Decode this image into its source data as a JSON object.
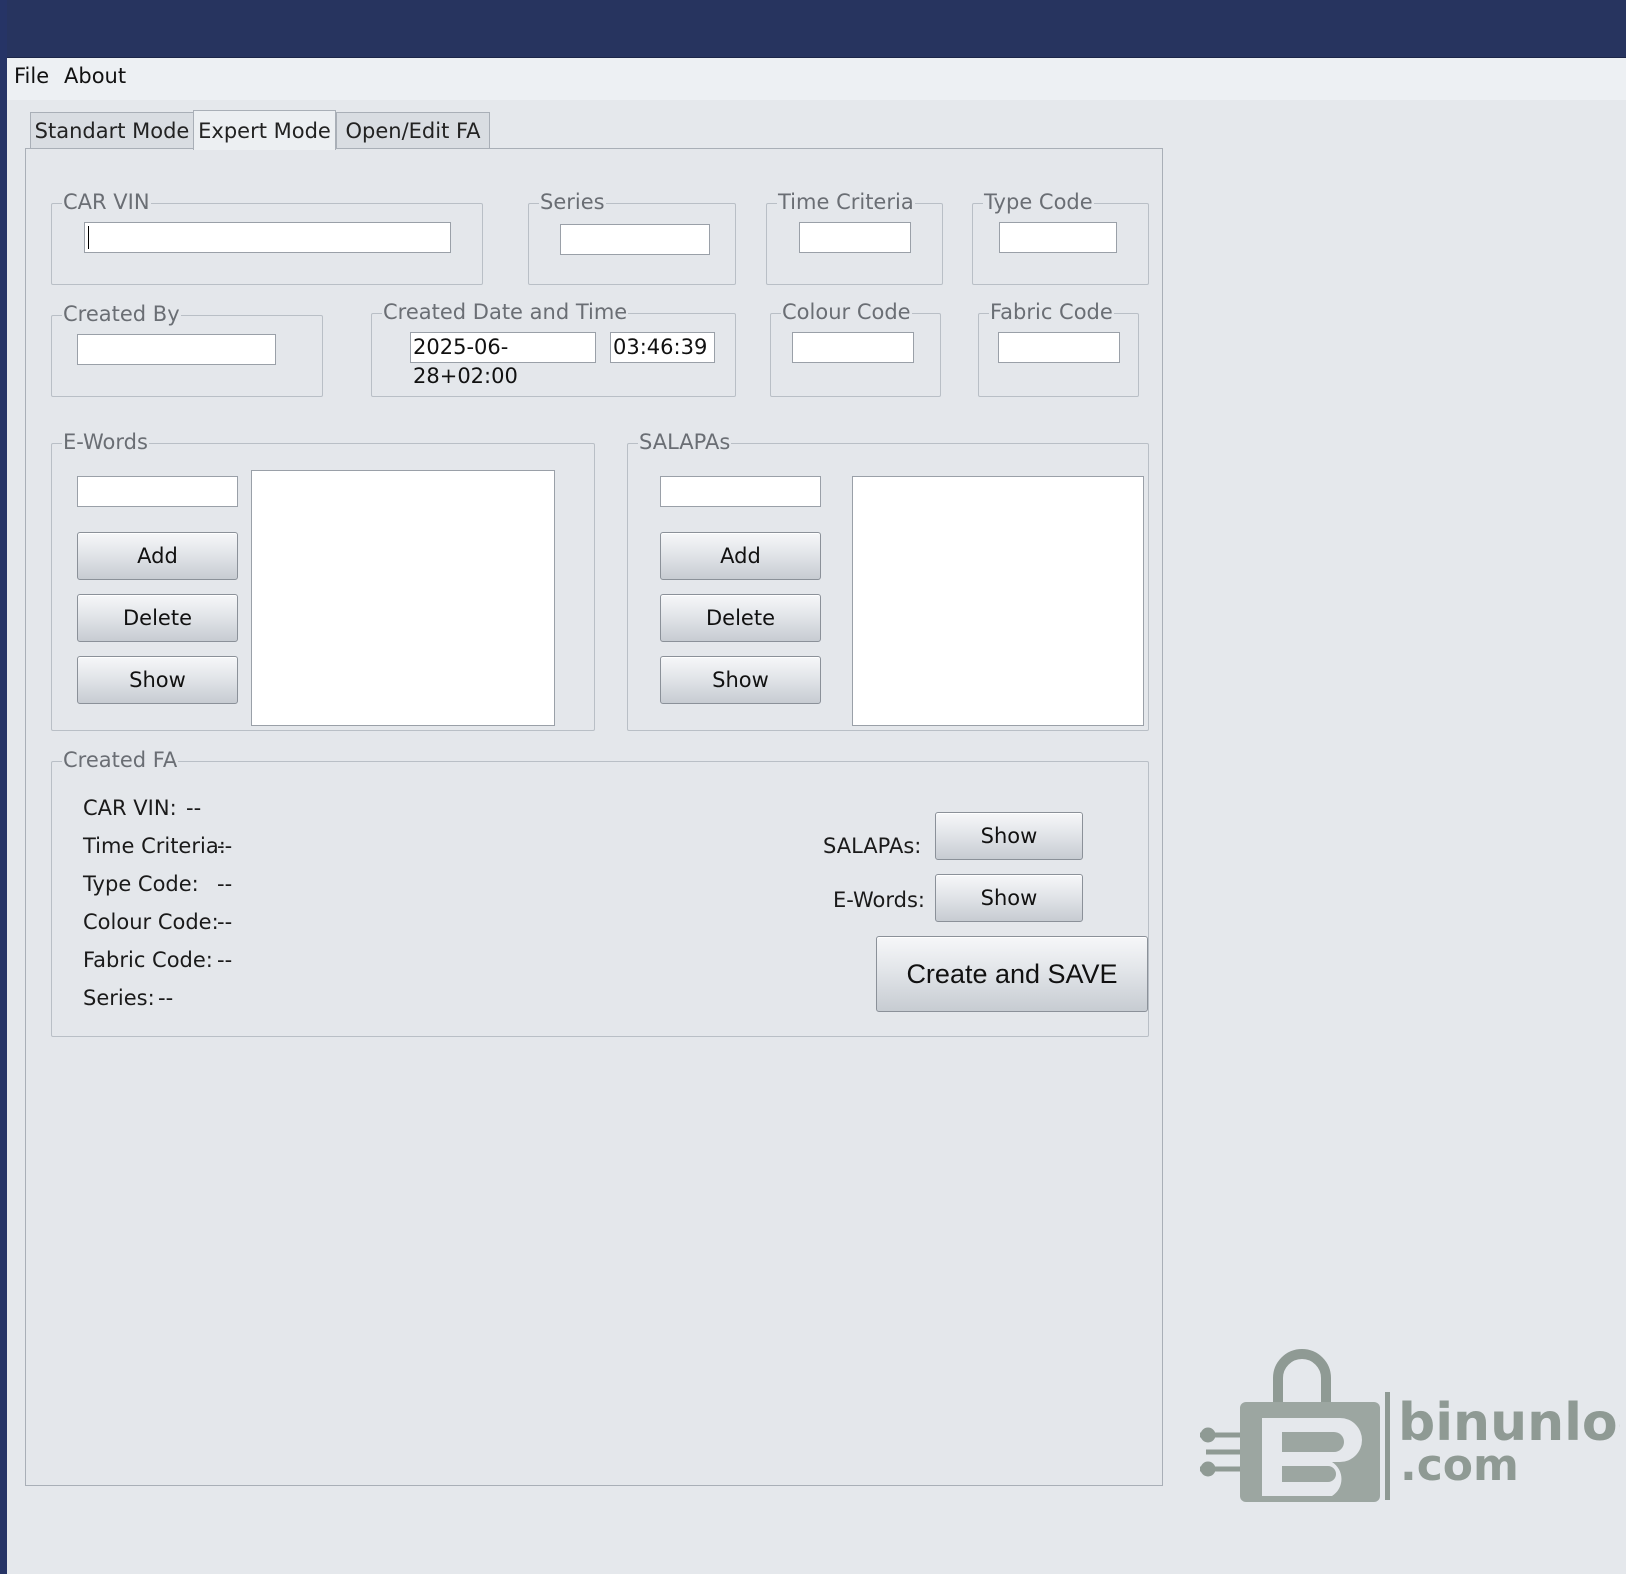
{
  "menu": {
    "file": "File",
    "about": "About"
  },
  "tabs": [
    {
      "label": "Standart Mode"
    },
    {
      "label": "Expert Mode"
    },
    {
      "label": "Open/Edit FA"
    }
  ],
  "form": {
    "car_vin": {
      "label": "CAR VIN",
      "value": ""
    },
    "series": {
      "label": "Series",
      "value": ""
    },
    "time_criteria": {
      "label": "Time Criteria",
      "value": ""
    },
    "type_code": {
      "label": "Type Code",
      "value": ""
    },
    "created_by": {
      "label": "Created By",
      "value": ""
    },
    "created_datetime": {
      "label": "Created Date and Time",
      "date": "2025-06-28+02:00",
      "time": "03:46:39"
    },
    "colour_code": {
      "label": "Colour Code",
      "value": ""
    },
    "fabric_code": {
      "label": "Fabric Code",
      "value": ""
    }
  },
  "ewords": {
    "label": "E-Words",
    "add": "Add",
    "delete": "Delete",
    "show": "Show"
  },
  "salapas": {
    "label": "SALAPAs",
    "add": "Add",
    "delete": "Delete",
    "show": "Show"
  },
  "created_fa": {
    "label": "Created FA",
    "car_vin": {
      "label": "CAR VIN:",
      "value": "--"
    },
    "time_criteria": {
      "label": "Time Criteria:",
      "value": "--"
    },
    "type_code": {
      "label": "Type Code:",
      "value": "--"
    },
    "colour_code": {
      "label": "Colour Code:",
      "value": "--"
    },
    "fabric_code": {
      "label": "Fabric Code:",
      "value": "--"
    },
    "series": {
      "label": "Series:",
      "value": "--"
    },
    "salapas_label": "SALAPAs:",
    "salapas_show": "Show",
    "ewords_label": "E-Words:",
    "ewords_show": "Show",
    "create_save": "Create and SAVE"
  },
  "watermark": {
    "text1": "binunlock",
    "text2": ".com"
  },
  "colors": {
    "titlebar": "#27345f",
    "window_bg": "#e5e8ec",
    "watermark": "#8a9590"
  }
}
